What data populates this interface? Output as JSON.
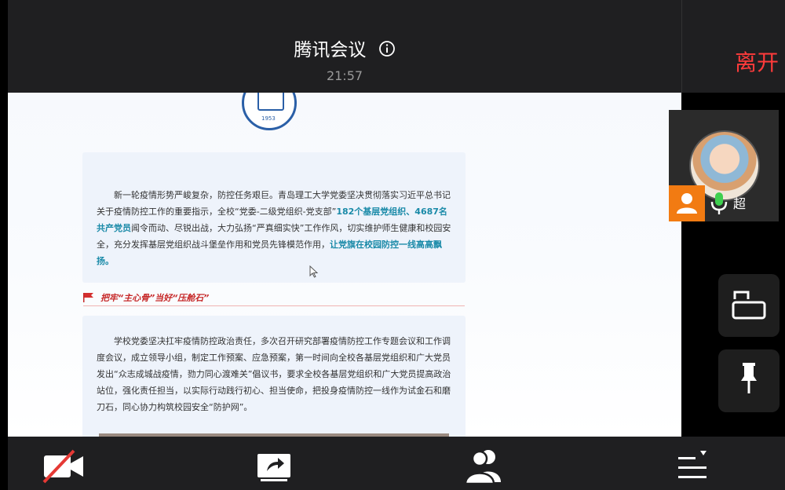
{
  "meeting": {
    "title": "腾讯会议",
    "clock": "21:57",
    "leave_label": "离开"
  },
  "document": {
    "logo_year": "1953",
    "paragraph1": {
      "p1": "新一轮疫情形势严峻复杂，防控任务艰巨。青岛理工大学党委坚决贯彻落实习近平总书记关于疫情防控工作的重要指示，全校“党委-二级党组织-党支部”",
      "h1": "182个基层党组织、4687名共产党员",
      "p2": "闻令而动、尽锐出战，大力弘扬“严真细实快”工作作风，切实维护师生健康和校园安全，充分发挥基层党组织战斗堡垒作用和党员先锋模范作用，",
      "h2": "让党旗在校园防控一线高高飘扬。"
    },
    "section_title": "把牢“主心骨”当好“压舱石”",
    "paragraph2": "学校党委坚决扛牢疫情防控政治责任，多次召开研究部署疫情防控工作专题会议和工作调度会议，成立领导小组，制定工作预案、应急预案，第一时间向全校各基层党组织和广大党员发出“众志成城战疫情，勠力同心渡难关”倡议书，要求全校各基层党组织和广大党员提高政治站位，强化责任担当，以实际行动践行初心、担当使命，把投身疫情防控一线作为试金石和磨刀石，同心协力构筑校园安全“防护网”。"
  },
  "participant": {
    "name": "超",
    "mic": "on"
  },
  "colors": {
    "accent_orange": "#f27b12",
    "leave_red": "#ff3b3b",
    "highlight_teal": "#1a8aa8",
    "section_red": "#c62828"
  },
  "icons": {
    "info": "info-icon",
    "camera_off": "camera-off-icon",
    "share": "share-screen-icon",
    "participants": "participants-icon",
    "more": "more-menu-icon",
    "lock_rotation": "lock-rotation-icon",
    "pin": "pin-icon",
    "mic": "mic-icon",
    "user": "user-icon"
  }
}
